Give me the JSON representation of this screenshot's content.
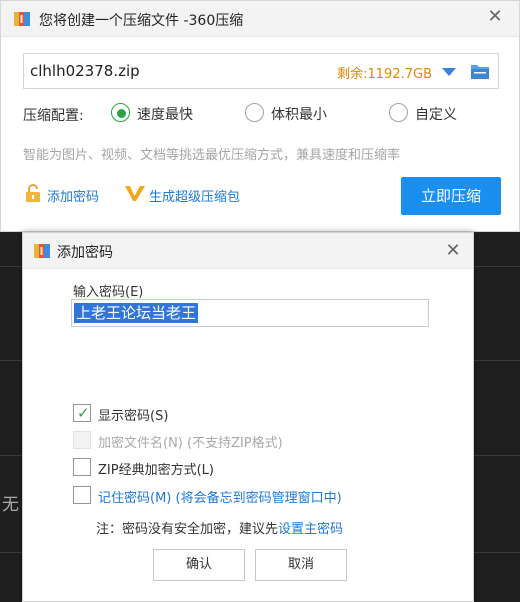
{
  "main_window": {
    "title": "您将创建一个压缩文件 -360压缩",
    "filename": "clhlh02378.zip",
    "space_remaining": "剩余:1192.7GB",
    "config_label": "压缩配置:",
    "options": [
      {
        "label": "速度最快",
        "checked": true
      },
      {
        "label": "体积最小",
        "checked": false
      },
      {
        "label": "自定义",
        "checked": false
      }
    ],
    "hint": "智能为图片、视频、文档等挑选最优压缩方式，兼具速度和压缩率",
    "add_password_label": "添加密码",
    "super_pack_label": "生成超级压缩包",
    "compress_button": "立即压缩"
  },
  "dialog": {
    "title": "添加密码",
    "password_label": "输入密码(E)",
    "password_value": "上老王论坛当老王",
    "checkboxes": [
      {
        "label": "显示密码(S)",
        "checked": true,
        "enabled": true
      },
      {
        "label": "加密文件名(N) (不支持ZIP格式)",
        "checked": false,
        "enabled": false
      },
      {
        "label": "ZIP经典加密方式(L)",
        "checked": false,
        "enabled": true
      },
      {
        "label": "记住密码(M) (将会备忘到密码管理窗口中)",
        "checked": false,
        "enabled": true
      }
    ],
    "note_prefix": "注：密码没有安全加密，建议先",
    "note_link": "设置主密码",
    "ok_button": "确认",
    "cancel_button": "取消"
  },
  "background": {
    "fragment_char": "无"
  },
  "colors": {
    "accent_blue": "#1a8ff0",
    "link_blue": "#1e78d6",
    "check_green": "#2ba245",
    "space_orange": "#e08a00"
  }
}
